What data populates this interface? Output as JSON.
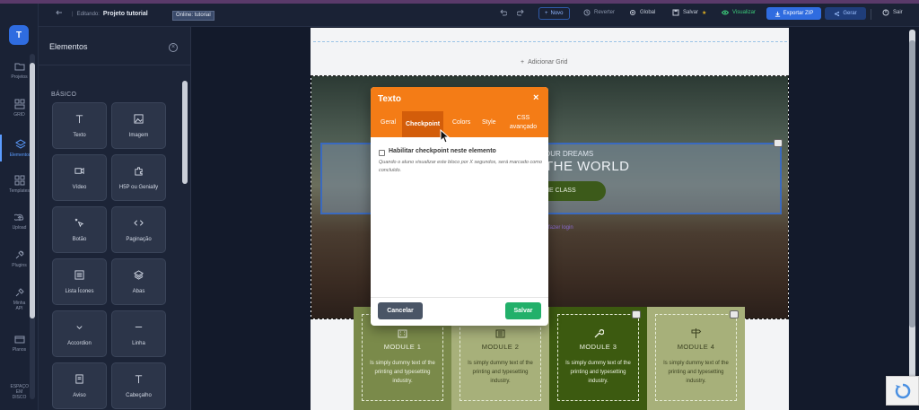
{
  "topbar": {
    "editing_label": "Editando:",
    "project_name": "Projeto tutorial",
    "online_tag": "Online: tutorial",
    "novo": "Novo",
    "reverter": "Reverter",
    "global": "Global",
    "salvar": "Salvar",
    "visualizar": "Visualizar",
    "exportar_zip": "Exportar ZIP",
    "gerar": "Gerar",
    "sair": "Sair"
  },
  "rail": {
    "avatar": "T",
    "items": [
      {
        "label": "Projetos",
        "icon": "folder-icon"
      },
      {
        "label": "GRID",
        "icon": "grid-icon"
      },
      {
        "label": "Elementos",
        "icon": "elements-icon"
      },
      {
        "label": "Templates",
        "icon": "templates-icon"
      },
      {
        "label": "Upload",
        "icon": "upload-icon"
      },
      {
        "label": "Plugins",
        "icon": "plugin-icon"
      },
      {
        "label": "Minha API",
        "icon": "api-icon"
      },
      {
        "label": "Planos",
        "icon": "card-icon"
      },
      {
        "label": "ESPAÇO EM DISCO",
        "icon": "disk-icon"
      }
    ]
  },
  "panel": {
    "title": "Elementos",
    "section": "BÁSICO",
    "cards": [
      {
        "label": "Texto",
        "icon": "text-icon"
      },
      {
        "label": "Imagem",
        "icon": "image-icon"
      },
      {
        "label": "Vídeo",
        "icon": "video-icon"
      },
      {
        "label": "H5P ou Genially",
        "icon": "puzzle-icon"
      },
      {
        "label": "Botão",
        "icon": "click-icon"
      },
      {
        "label": "Paginação",
        "icon": "code-icon"
      },
      {
        "label": "Lista Ícones",
        "icon": "list-icon"
      },
      {
        "label": "Abas",
        "icon": "layers-icon"
      },
      {
        "label": "Accordion",
        "icon": "chevron-down-icon"
      },
      {
        "label": "Linha",
        "icon": "minus-icon"
      },
      {
        "label": "Aviso",
        "icon": "notice-icon"
      },
      {
        "label": "Cabeçalho",
        "icon": "heading-icon"
      }
    ]
  },
  "canvas": {
    "add_grid": "Adicionar Grid",
    "hero_line1": "OUR DREAMS",
    "hero_line2": "THE WORLD",
    "hero_button": "HE CLASS",
    "hero_link": "fazer login",
    "modules": [
      {
        "title": "MODULE 1",
        "text": "Is simply dummy text of the printing and typesetting industry."
      },
      {
        "title": "MODULE 2",
        "text": "Is simply dummy text of the printing and typesetting industry."
      },
      {
        "title": "MODULE 3",
        "text": "Is simply dummy text of the printing and typesetting industry."
      },
      {
        "title": "MODULE 4",
        "text": "Is simply dummy text of the printing and typesetting industry."
      }
    ]
  },
  "modal": {
    "title": "Texto",
    "close": "×",
    "tabs": [
      "Geral",
      "Checkpoint",
      "Colors",
      "Style",
      "CSS avançado"
    ],
    "active_tab": "Checkpoint",
    "checkbox_label": "Habilitar checkpoint neste elemento",
    "checkbox_checked": false,
    "help_text": "Quando o aluno visualizar este bloco por X segundos, será marcado como concluído.",
    "cancel": "Cancelar",
    "save": "Salvar"
  },
  "colors": {
    "accent_orange": "#f47c16",
    "primary_blue": "#2f6ce0",
    "save_green": "#22b06a"
  }
}
